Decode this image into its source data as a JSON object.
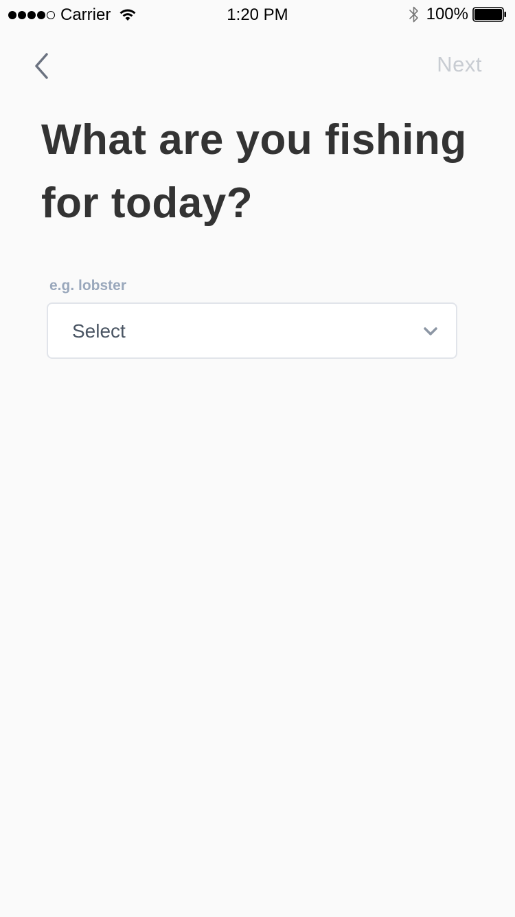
{
  "status_bar": {
    "carrier": "Carrier",
    "time": "1:20 PM",
    "battery": "100%",
    "signal_bars_filled": 4,
    "signal_bars_total": 5
  },
  "nav": {
    "back_icon": "chevron-left-icon",
    "next_label": "Next"
  },
  "title": "What are you fishing for today?",
  "field": {
    "label": "e.g. lobster",
    "value": "Select",
    "icon": "chevron-down-icon"
  },
  "colors": {
    "background": "#fafafa",
    "title": "#333333",
    "label": "#9aa8bc",
    "next_disabled": "#c8ccd2",
    "field_border": "#e1e4ea"
  }
}
